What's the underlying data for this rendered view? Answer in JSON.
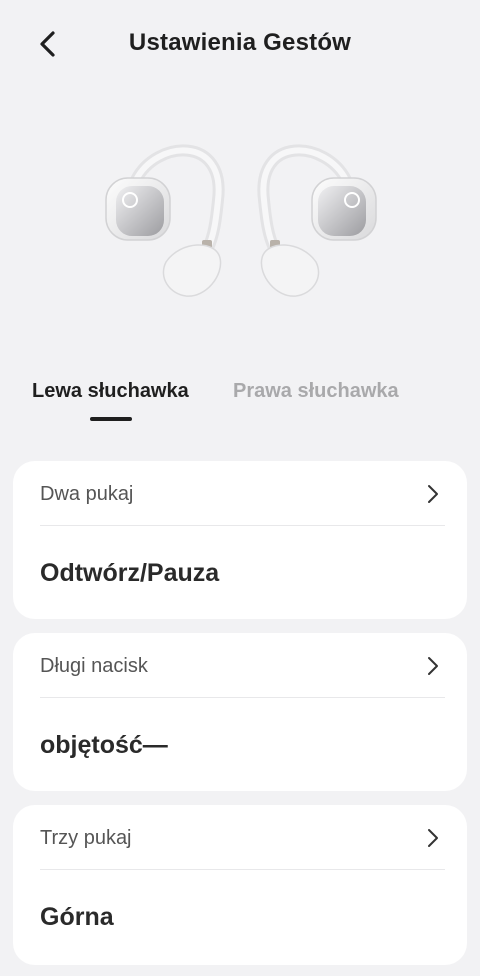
{
  "header": {
    "title": "Ustawienia Gestów",
    "back_icon": "chevron-left-icon"
  },
  "tabs": [
    {
      "label": "Lewa słuchawka",
      "active": true
    },
    {
      "label": "Prawa słuchawka",
      "active": false
    }
  ],
  "gestures": [
    {
      "label": "Dwa pukaj",
      "value": "Odtwórz/Pauza"
    },
    {
      "label": "Długi nacisk",
      "value": "objętość—"
    },
    {
      "label": "Trzy pukaj",
      "value": "Górna"
    }
  ],
  "colors": {
    "background": "#f2f2f4",
    "card": "#ffffff",
    "active_tab": "#1f1f1f",
    "inactive_tab": "#a9a9ab"
  }
}
